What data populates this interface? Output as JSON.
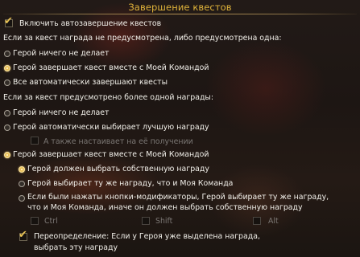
{
  "title": "Завершение квестов",
  "enable_autocomplete": {
    "label": "Включить автозавершение квестов",
    "checked": true
  },
  "section_none_or_one": {
    "heading": "Если за квест награда не предусмотрена, либо предусмотрена одна:",
    "options": [
      {
        "label": "Герой ничего не делает",
        "selected": false
      },
      {
        "label": "Герой завершает квест вместе с Моей Командой",
        "selected": true
      },
      {
        "label": "Все автоматически завершают квесты",
        "selected": false
      }
    ]
  },
  "section_multiple": {
    "heading": "Если за квест предусмотрено более одной награды:",
    "option_nothing": {
      "label": "Герой ничего не делает",
      "selected": false
    },
    "option_best": {
      "label": "Герой автоматически выбирает лучшую награду",
      "selected": false
    },
    "also_insist": {
      "label": "А также настаивает на её получении",
      "checked": false,
      "disabled": true
    },
    "option_team": {
      "label": "Герой завершает квест вместе с Моей Командой",
      "selected": true
    },
    "sub_options": [
      {
        "label": "Герой должен выбрать собственную награду",
        "selected": true
      },
      {
        "label": "Герой выбирает ту же награду, что и Моя Команда",
        "selected": false
      },
      {
        "label_line1": "Если были нажаты кнопки-модификаторы, Герой выбирает ту же награду,",
        "label_line2": "что и Моя Команда, иначе он должен выбрать собственную награду",
        "selected": false
      }
    ],
    "modifiers": [
      {
        "label": "Ctrl",
        "checked": false
      },
      {
        "label": "Shift",
        "checked": false
      },
      {
        "label": "Alt",
        "checked": false
      }
    ],
    "override": {
      "label_line1": "Переопределение: Если у Героя уже выделена награда,",
      "label_line2": "выбрать эту награду",
      "checked": true
    }
  },
  "colors": {
    "title": "#e0b33a",
    "text": "#f1efe9",
    "disabled_text": "#7b7774",
    "accent": "#e9c05a"
  }
}
